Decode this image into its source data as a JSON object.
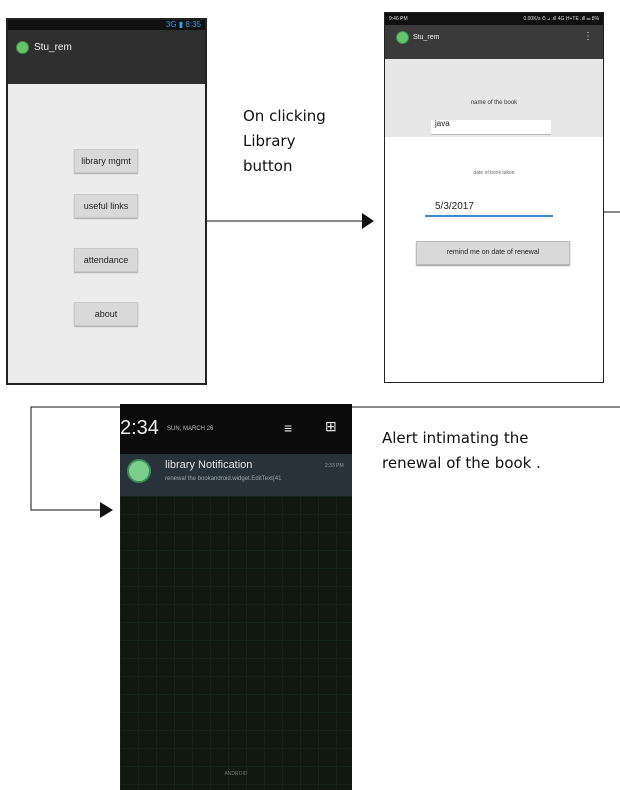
{
  "screen1": {
    "status": "3G ▮ 8:35",
    "app_title": "Stu_rem",
    "buttons": [
      "library mgmt",
      "useful links",
      "attendance",
      "about"
    ]
  },
  "step_label": [
    "On clicking",
    "Library",
    "button"
  ],
  "screen2": {
    "status_left": "9:46 PM",
    "status_right": "0.00K/s ⏱ ⊿ .ıll 4G H+TE .ıll ▭ 8%",
    "app_title": "Stu_rem",
    "menu_icon": "overflow-menu-icon",
    "field1_label": "name of the book",
    "field1_value": "java",
    "field2_label": "date of book taken",
    "field2_value": "5/3/2017",
    "button": "remind me on date of renewal"
  },
  "screen3": {
    "time": "2:34",
    "date": "SUN, MARCH 26",
    "notification_title": "library Notification",
    "notification_time": "2:33 PM",
    "notification_text": "renewal the bookandroid.widget.EditText{41",
    "footer": "ANDROID"
  },
  "alert_label": [
    "Alert intimating the",
    "renewal of the book ."
  ],
  "colors": {
    "accent_blue": "#3b88c9",
    "app_icon": "#67c36b",
    "notification_bg": "#27323b"
  }
}
